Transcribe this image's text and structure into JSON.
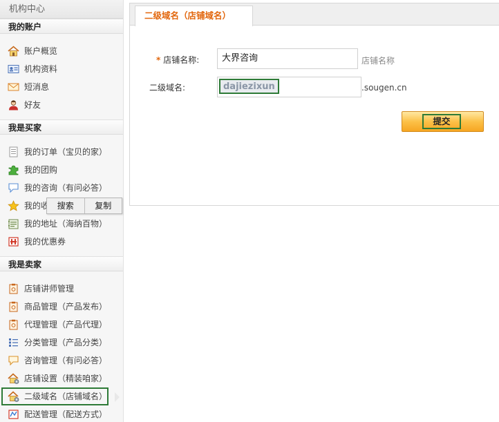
{
  "sidebar": {
    "title": "机构中心",
    "sections": [
      {
        "header": "我的账户",
        "items": [
          {
            "label": "账户概览",
            "icon": "home-icon"
          },
          {
            "label": "机构资料",
            "icon": "id-card-icon"
          },
          {
            "label": "短消息",
            "icon": "envelope-icon"
          },
          {
            "label": "好友",
            "icon": "user-icon"
          }
        ]
      },
      {
        "header": "我是买家",
        "items": [
          {
            "label": "我的订单（宝贝的家）",
            "icon": "document-icon"
          },
          {
            "label": "我的团购",
            "icon": "puzzle-icon"
          },
          {
            "label": "我的咨询（有问必答）",
            "icon": "speech-bubble-icon"
          },
          {
            "label": "我的收",
            "icon": "star-icon"
          },
          {
            "label": "我的地址（海纳百物）",
            "icon": "address-book-icon"
          },
          {
            "label": "我的优惠券",
            "icon": "coupon-icon"
          }
        ]
      },
      {
        "header": "我是卖家",
        "items": [
          {
            "label": "店铺讲师管理",
            "icon": "clipboard-icon"
          },
          {
            "label": "商品管理（产品发布）",
            "icon": "clipboard-icon"
          },
          {
            "label": "代理管理（产品代理）",
            "icon": "clipboard-icon"
          },
          {
            "label": "分类管理（产品分类）",
            "icon": "list-icon"
          },
          {
            "label": "咨询管理（有问必答）",
            "icon": "speech-bubble-icon"
          },
          {
            "label": "店铺设置（精装咱家）",
            "icon": "shop-settings-icon"
          },
          {
            "label": "二级域名（店铺域名）",
            "icon": "shop-settings-icon"
          },
          {
            "label": "配送管理（配送方式）",
            "icon": "delivery-icon"
          }
        ]
      }
    ]
  },
  "context_menu": {
    "search": "搜索",
    "copy": "复制"
  },
  "main": {
    "tab_label": "二级域名（店铺域名）",
    "form": {
      "required_mark": "*",
      "shop_name_label": "店铺名称:",
      "shop_name_value": "大界咨询",
      "shop_name_hint": "店铺名称",
      "subdomain_label": "二级域名:",
      "subdomain_value": "dajiezixun",
      "subdomain_suffix": ".sougen.cn",
      "submit_label": "提交"
    }
  },
  "colors": {
    "accent_orange": "#e2660c",
    "highlight_green": "#2d7a36"
  }
}
